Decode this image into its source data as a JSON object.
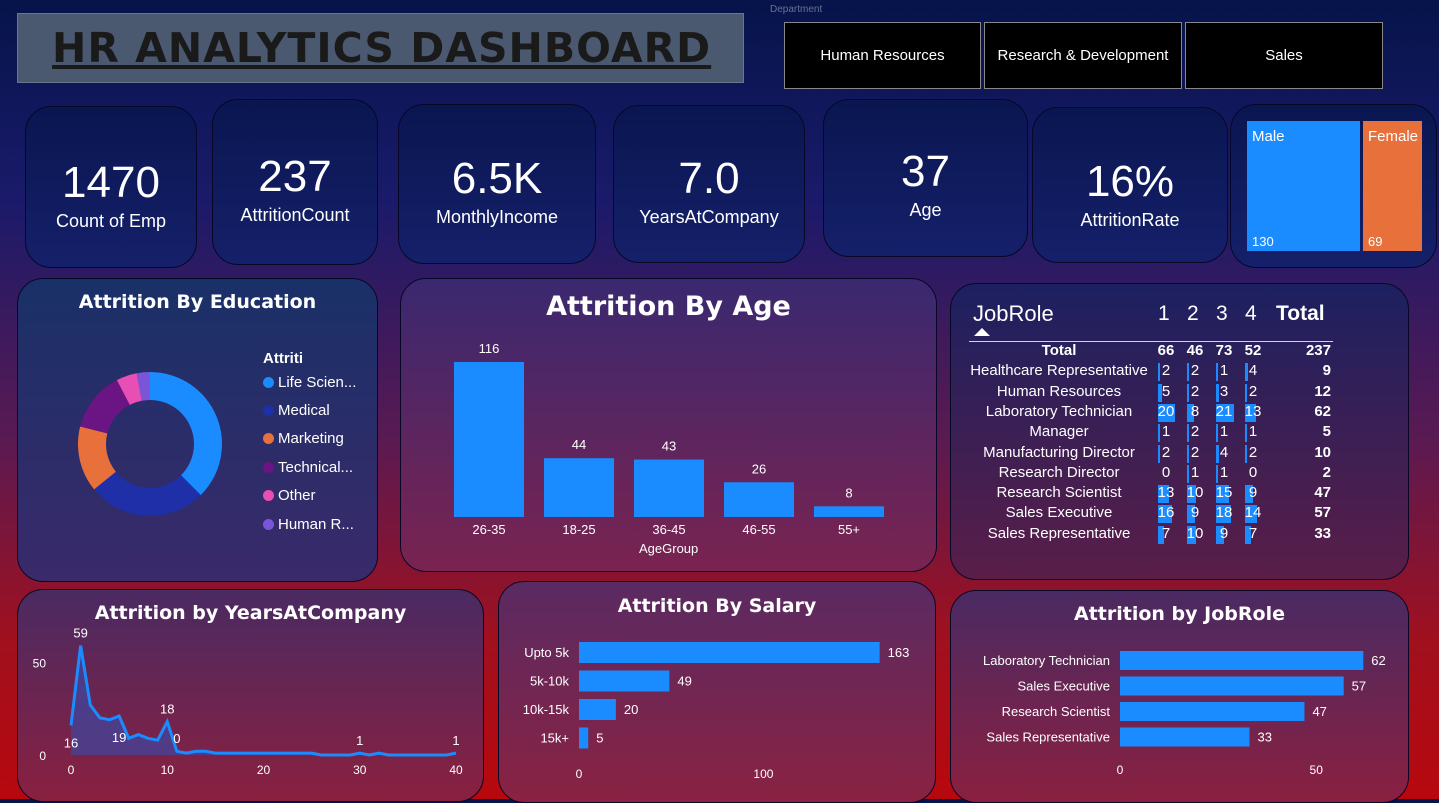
{
  "header": {
    "title": "HR ANALYTICS DASHBOARD",
    "slicer_label": "Department",
    "departments": [
      "Human Resources",
      "Research & Development",
      "Sales"
    ]
  },
  "kpis": [
    {
      "value": "1470",
      "label": "Count of Emp"
    },
    {
      "value": "237",
      "label": "AttritionCount"
    },
    {
      "value": "6.5K",
      "label": "MonthlyIncome"
    },
    {
      "value": "7.0",
      "label": "YearsAtCompany"
    },
    {
      "value": "37",
      "label": "Age"
    },
    {
      "value": "16%",
      "label": "AttritionRate"
    }
  ],
  "gender": {
    "male_label": "Male",
    "male_value": "130",
    "female_label": "Female",
    "female_value": "69",
    "colors": {
      "male": "#1a8cff",
      "female": "#e8703a"
    }
  },
  "education": {
    "title": "Attrition By Education",
    "legend_title": "Attriti",
    "legend": [
      {
        "label": "Life Scien...",
        "color": "#1a8cff"
      },
      {
        "label": "Medical",
        "color": "#1f2fa8"
      },
      {
        "label": "Marketing",
        "color": "#e8703a"
      },
      {
        "label": "Technical...",
        "color": "#6b1483"
      },
      {
        "label": "Other",
        "color": "#e84fb4"
      },
      {
        "label": "Human R...",
        "color": "#7b55d8"
      }
    ]
  },
  "age_chart": {
    "title": "Attrition By Age",
    "xlabel": "AgeGroup"
  },
  "jobrole_matrix": {
    "header": "JobRole",
    "columns": [
      "1",
      "2",
      "3",
      "4",
      "Total"
    ],
    "total_row": {
      "label": "Total",
      "values": [
        "66",
        "46",
        "73",
        "52",
        "237"
      ]
    },
    "rows": [
      {
        "label": "Healthcare Representative",
        "values": [
          "2",
          "2",
          "1",
          "4",
          "9"
        ]
      },
      {
        "label": "Human Resources",
        "values": [
          "5",
          "2",
          "3",
          "2",
          "12"
        ]
      },
      {
        "label": "Laboratory Technician",
        "values": [
          "20",
          "8",
          "21",
          "13",
          "62"
        ]
      },
      {
        "label": "Manager",
        "values": [
          "1",
          "2",
          "1",
          "1",
          "5"
        ]
      },
      {
        "label": "Manufacturing Director",
        "values": [
          "2",
          "2",
          "4",
          "2",
          "10"
        ]
      },
      {
        "label": "Research Director",
        "values": [
          "0",
          "1",
          "1",
          "0",
          "2"
        ]
      },
      {
        "label": "Research Scientist",
        "values": [
          "13",
          "10",
          "15",
          "9",
          "47"
        ]
      },
      {
        "label": "Sales Executive",
        "values": [
          "16",
          "9",
          "18",
          "14",
          "57"
        ]
      },
      {
        "label": "Sales Representative",
        "values": [
          "7",
          "10",
          "9",
          "7",
          "33"
        ]
      }
    ]
  },
  "years_chart": {
    "title": "Attrition by YearsAtCompany"
  },
  "salary_chart": {
    "title": "Attrition By Salary"
  },
  "jobrole_chart": {
    "title": "Attrition by JobRole"
  },
  "chart_data": [
    {
      "type": "pie",
      "title": "Attrition By Education",
      "categories": [
        "Life Sciences",
        "Medical",
        "Marketing",
        "Technical Degree",
        "Other",
        "Human Resources"
      ],
      "values": [
        89,
        63,
        35,
        32,
        11,
        7
      ],
      "colors": [
        "#1a8cff",
        "#1f2fa8",
        "#e8703a",
        "#6b1483",
        "#e84fb4",
        "#7b55d8"
      ]
    },
    {
      "type": "bar",
      "title": "Attrition By Age",
      "xlabel": "AgeGroup",
      "categories": [
        "26-35",
        "18-25",
        "36-45",
        "46-55",
        "55+"
      ],
      "values": [
        116,
        44,
        43,
        26,
        8
      ],
      "color": "#1a8cff"
    },
    {
      "type": "area",
      "title": "Attrition by YearsAtCompany",
      "x": [
        0,
        1,
        2,
        3,
        4,
        5,
        6,
        7,
        8,
        9,
        10,
        11,
        12,
        13,
        14,
        15,
        16,
        17,
        18,
        19,
        20,
        21,
        22,
        23,
        24,
        25,
        26,
        27,
        28,
        29,
        30,
        31,
        32,
        33,
        34,
        35,
        36,
        37,
        38,
        39,
        40
      ],
      "y": [
        16,
        59,
        27,
        20,
        19,
        21,
        9,
        11,
        9,
        8,
        18,
        2,
        1,
        2,
        2,
        1,
        1,
        1,
        1,
        1,
        1,
        1,
        1,
        1,
        1,
        1,
        0,
        0,
        0,
        0,
        1,
        0,
        1,
        0,
        0,
        0,
        0,
        0,
        0,
        0,
        1
      ],
      "xticks": [
        0,
        10,
        20,
        30,
        40
      ],
      "yticks": [
        0,
        50
      ],
      "xlim": [
        0,
        40
      ],
      "ylim": [
        0,
        62
      ],
      "labels": [
        {
          "x": 0,
          "y": 16
        },
        {
          "x": 1,
          "y": 59
        },
        {
          "x": 5,
          "y": 19
        },
        {
          "x": 10,
          "y": 18
        },
        {
          "x": 11,
          "y": 0
        },
        {
          "x": 30,
          "y": 1
        },
        {
          "x": 40,
          "y": 1
        }
      ],
      "color": "#1a8cff"
    },
    {
      "type": "bar",
      "orientation": "horizontal",
      "title": "Attrition By Salary",
      "categories": [
        "Upto 5k",
        "5k-10k",
        "10k-15k",
        "15k+"
      ],
      "values": [
        163,
        49,
        20,
        5
      ],
      "xticks": [
        0,
        100
      ],
      "xlim": [
        0,
        180
      ],
      "color": "#1a8cff"
    },
    {
      "type": "bar",
      "orientation": "horizontal",
      "title": "Attrition by JobRole",
      "categories": [
        "Laboratory Technician",
        "Sales Executive",
        "Research Scientist",
        "Sales Representative"
      ],
      "values": [
        62,
        57,
        47,
        33
      ],
      "xticks": [
        0,
        50
      ],
      "xlim": [
        0,
        66
      ],
      "color": "#1a8cff"
    }
  ]
}
